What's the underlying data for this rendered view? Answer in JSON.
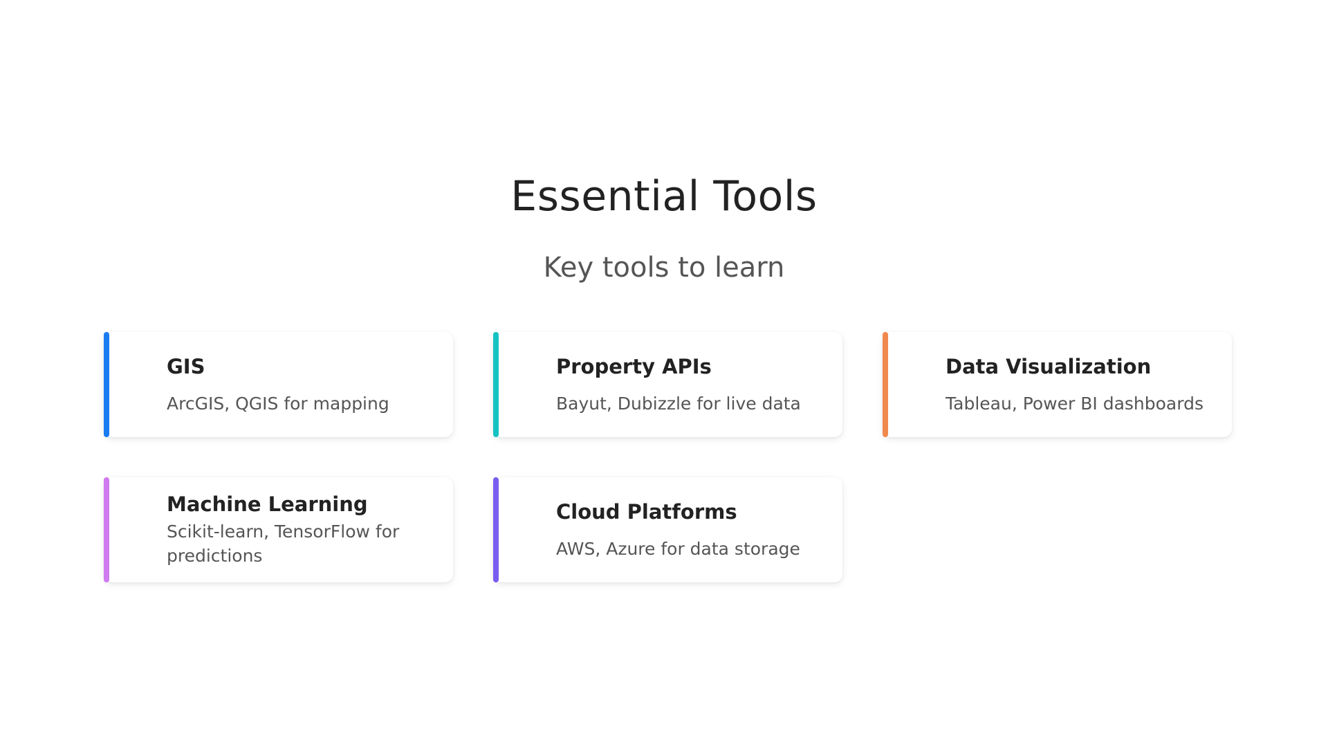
{
  "header": {
    "title": "Essential Tools",
    "subtitle": "Key tools to learn"
  },
  "cards": [
    {
      "title": "GIS",
      "description": "ArcGIS, QGIS for mapping",
      "accent_color": "#1a7cf2"
    },
    {
      "title": "Property APIs",
      "description": "Bayut, Dubizzle for live data",
      "accent_color": "#17c2c2"
    },
    {
      "title": "Data Visualization",
      "description": "Tableau, Power BI dashboards",
      "accent_color": "#f0894e"
    },
    {
      "title": "Machine Learning",
      "description": "Scikit-learn, TensorFlow for predictions",
      "accent_color": "#d07af0"
    },
    {
      "title": "Cloud Platforms",
      "description": "AWS, Azure for data storage",
      "accent_color": "#7a5cf0"
    }
  ]
}
